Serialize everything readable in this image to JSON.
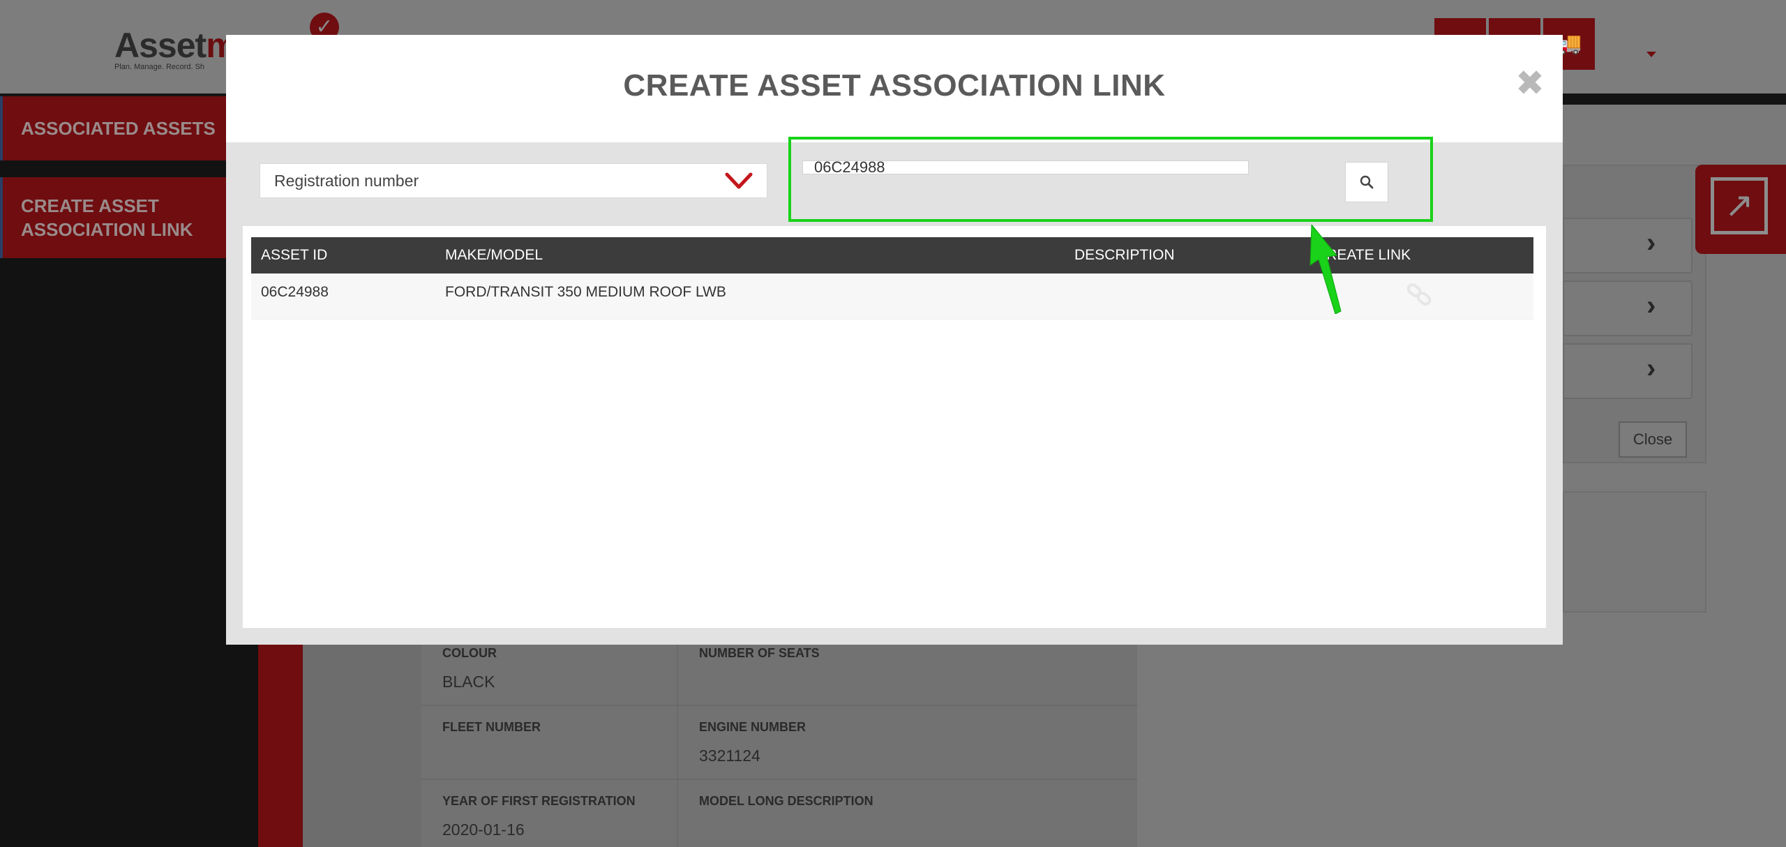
{
  "background": {
    "logo": {
      "text_a": "Asset",
      "text_b": "m",
      "tagline": "Plan. Manage. Record. Sh"
    },
    "sidebar": {
      "items": [
        {
          "label": "ASSOCIATED ASSETS"
        },
        {
          "label": "CREATE ASSET ASSOCIATION LINK"
        }
      ]
    },
    "details": {
      "colour_label": "COLOUR",
      "colour_value": "BLACK",
      "seats_label": "NUMBER OF SEATS",
      "fleet_label": "FLEET NUMBER",
      "engine_label": "ENGINE NUMBER",
      "engine_value": "3321124",
      "first_reg_label": "YEAR OF FIRST REGISTRATION",
      "first_reg_value": "2020-01-16",
      "model_desc_label": "MODEL LONG DESCRIPTION"
    },
    "right_panel": {
      "close_label": "Close"
    }
  },
  "modal": {
    "title": "CREATE ASSET ASSOCIATION LINK",
    "close_glyph": "✖",
    "filter": {
      "selected": "Registration number"
    },
    "search": {
      "value": "06C24988"
    },
    "table": {
      "columns": [
        "ASSET ID",
        "MAKE/MODEL",
        "DESCRIPTION",
        "CREATE LINK"
      ],
      "rows": [
        {
          "asset_id": "06C24988",
          "make_model": "FORD/TRANSIT 350 MEDIUM ROOF LWB",
          "description": ""
        }
      ]
    }
  },
  "colors": {
    "brand_red": "#c4161c",
    "highlight_green": "#19d219",
    "table_header": "#3c3c3c"
  }
}
